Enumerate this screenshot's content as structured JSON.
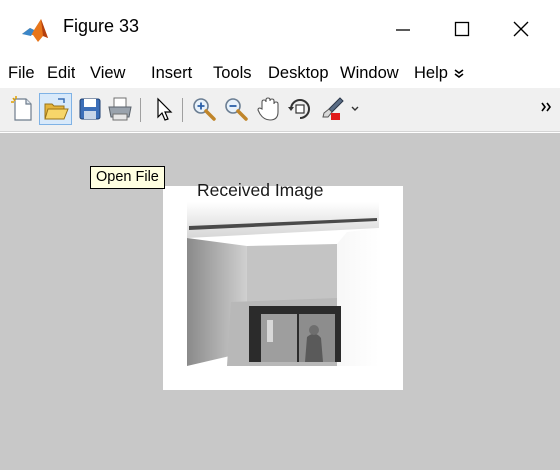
{
  "window": {
    "title": "Figure 33",
    "app_icon": "matlab-icon",
    "controls": [
      "minimize-icon",
      "maximize-icon",
      "close-icon"
    ]
  },
  "menubar": {
    "items": [
      "File",
      "Edit",
      "View",
      "Insert",
      "Tools",
      "Desktop",
      "Window",
      "Help"
    ],
    "overflow_icon": "double-chevron-icon"
  },
  "toolbar": {
    "buttons": [
      "new-figure-icon",
      "open-file-icon",
      "save-icon",
      "print-icon",
      "select-arrow-icon",
      "zoom-in-icon",
      "zoom-out-icon",
      "pan-hand-icon",
      "rotate-3d-icon",
      "brush-icon",
      "dropdown-arrow-icon"
    ],
    "overflow_icon": "double-chevron-icon"
  },
  "tooltip": {
    "text": "Open File"
  },
  "axes": {
    "title": "Received Image",
    "image_icon": "grayscale-photo-image"
  },
  "colors": {
    "figure_background": "#c8c8c8",
    "toolbar_background": "#f0f0f0",
    "tooltip_background": "#ffffe1",
    "matlab_orange": "#e8761b"
  }
}
